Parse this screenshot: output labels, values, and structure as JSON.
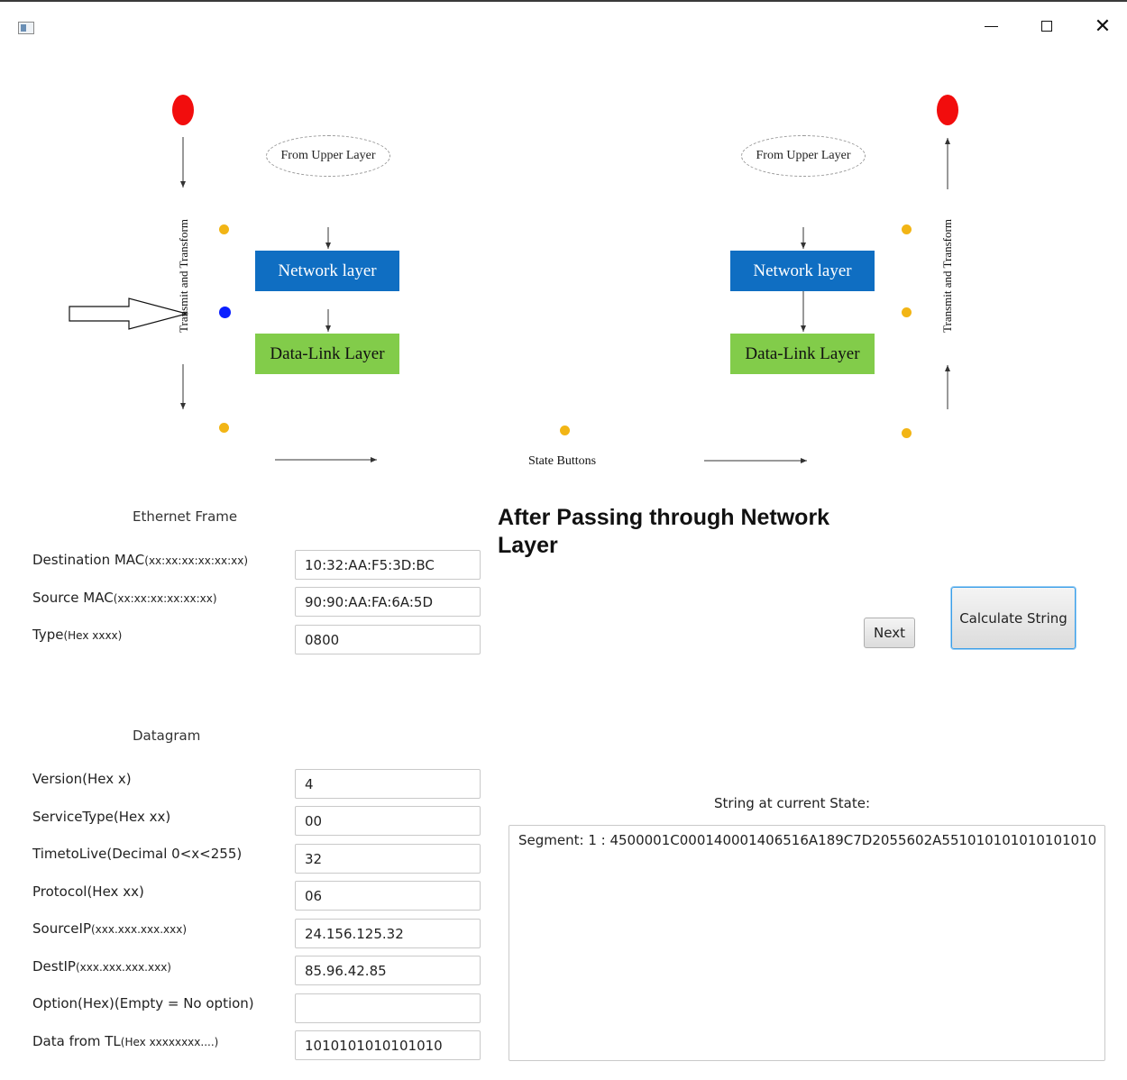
{
  "window": {
    "minimize_glyph": "",
    "close_glyph": "✕"
  },
  "diagram": {
    "left_ellipse": "From Upper Layer",
    "right_ellipse": "From Upper Layer",
    "left_network": "Network layer",
    "left_datalink": "Data-Link Layer",
    "right_network": "Network layer",
    "right_datalink": "Data-Link Layer",
    "left_vertical": "Transmit and Transform",
    "right_vertical": "Transmit and Transform",
    "state_buttons": "State Buttons",
    "colors": {
      "network": "#0f6ec2",
      "datalink": "#82cc4a",
      "red_state": "#f20d0d",
      "active_state": "#0a1fff",
      "idle_state": "#f2b515"
    }
  },
  "ethernet": {
    "title": "Ethernet Frame",
    "fields": [
      {
        "label": "Destination MAC",
        "hint": "(xx:xx:xx:xx:xx:xx)",
        "value": "10:32:AA:F5:3D:BC"
      },
      {
        "label": "Source MAC",
        "hint": "(xx:xx:xx:xx:xx:xx)",
        "value": "90:90:AA:FA:6A:5D"
      },
      {
        "label": "Type",
        "hint": "(Hex xxxx)",
        "value": "0800"
      }
    ]
  },
  "datagram": {
    "title": "Datagram",
    "fields": [
      {
        "label": "Version(Hex x)",
        "hint": "",
        "value": "4"
      },
      {
        "label": "ServiceType(Hex xx)",
        "hint": "",
        "value": "00"
      },
      {
        "label": "TimetoLive(Decimal 0<x<255)",
        "hint": "",
        "value": "32"
      },
      {
        "label": "Protocol(Hex xx)",
        "hint": "",
        "value": "06"
      },
      {
        "label": "SourceIP",
        "hint": "(xxx.xxx.xxx.xxx)",
        "value": "24.156.125.32"
      },
      {
        "label": "DestIP",
        "hint": "(xxx.xxx.xxx.xxx)",
        "value": "85.96.42.85"
      },
      {
        "label": "Option(Hex)(Empty = No option)",
        "hint": "",
        "value": ""
      },
      {
        "label": "Data from TL",
        "hint": "(Hex xxxxxxxx....)",
        "value": "1010101010101010"
      }
    ]
  },
  "main": {
    "heading": "After Passing through Network Layer",
    "next_button": "Next",
    "calculate_button": "Calculate String",
    "string_label": "String at current State:",
    "output": "Segment: 1  :  4500001C000140001406516A189C7D2055602A551010101010101010"
  }
}
